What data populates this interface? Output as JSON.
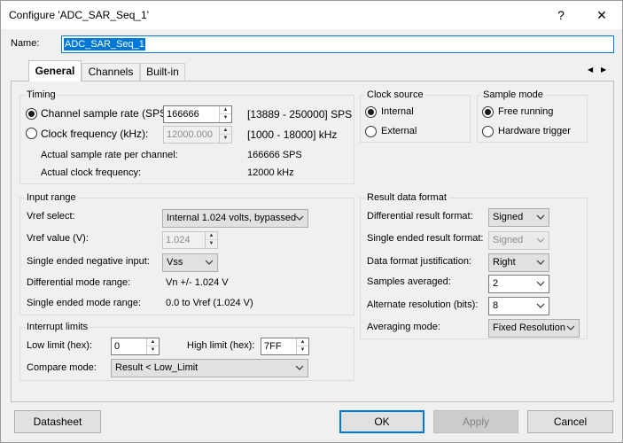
{
  "window": {
    "title": "Configure 'ADC_SAR_Seq_1'",
    "help_label": "?",
    "close_label": "✕"
  },
  "name_field": {
    "label": "Name:",
    "value": "ADC_SAR_Seq_1"
  },
  "tabs": [
    {
      "label": "General",
      "active": true
    },
    {
      "label": "Channels",
      "active": false
    },
    {
      "label": "Built-in",
      "active": false
    }
  ],
  "tab_scroll": {
    "left": "◀",
    "right": "▶"
  },
  "timing": {
    "title": "Timing",
    "sample_rate": {
      "label": "Channel sample rate (SPS):",
      "value": "166666",
      "range": "[13889 - 250000] SPS",
      "selected": true
    },
    "clock_freq": {
      "label": "Clock frequency (kHz):",
      "value": "12000.000",
      "range": "[1000 - 18000] kHz",
      "selected": false
    },
    "actual_rate": {
      "label": "Actual sample rate per channel:",
      "value": "166666 SPS"
    },
    "actual_clock": {
      "label": "Actual clock frequency:",
      "value": "12000 kHz"
    }
  },
  "clock_source": {
    "title": "Clock source",
    "options": [
      {
        "label": "Internal",
        "selected": true
      },
      {
        "label": "External",
        "selected": false
      }
    ]
  },
  "sample_mode": {
    "title": "Sample mode",
    "options": [
      {
        "label": "Free running",
        "selected": true
      },
      {
        "label": "Hardware trigger",
        "selected": false
      }
    ]
  },
  "input_range": {
    "title": "Input range",
    "vref_select": {
      "label": "Vref select:",
      "value": "Internal 1.024 volts, bypassed"
    },
    "vref_value": {
      "label": "Vref value (V):",
      "value": "1.024"
    },
    "neg_input": {
      "label": "Single ended negative input:",
      "value": "Vss"
    },
    "diff_range": {
      "label": "Differential mode range:",
      "value": "Vn +/- 1.024 V"
    },
    "se_range": {
      "label": "Single ended mode range:",
      "value": "0.0 to Vref (1.024 V)"
    }
  },
  "result_format": {
    "title": "Result data format",
    "diff_format": {
      "label": "Differential result format:",
      "value": "Signed"
    },
    "se_format": {
      "label": "Single ended result format:",
      "value": "Signed"
    },
    "justification": {
      "label": "Data format justification:",
      "value": "Right"
    },
    "samples_avg": {
      "label": "Samples averaged:",
      "value": "2"
    },
    "alt_res": {
      "label": "Alternate resolution (bits):",
      "value": "8"
    },
    "avg_mode": {
      "label": "Averaging mode:",
      "value": "Fixed Resolution"
    }
  },
  "interrupt": {
    "title": "Interrupt limits",
    "low": {
      "label": "Low limit (hex):",
      "value": "0"
    },
    "high": {
      "label": "High limit (hex):",
      "value": "7FF"
    },
    "compare": {
      "label": "Compare mode:",
      "value": "Result < Low_Limit"
    }
  },
  "buttons": {
    "datasheet": "Datasheet",
    "ok": "OK",
    "apply": "Apply",
    "cancel": "Cancel"
  },
  "colors": {
    "accent": "#0078d7",
    "selection": "#0078d7",
    "window_bg": "#f0f0f0"
  }
}
